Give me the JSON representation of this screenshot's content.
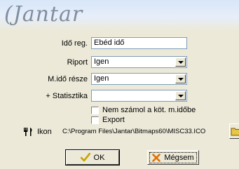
{
  "logo_text": "(Jantar",
  "form": {
    "ido_reg": {
      "label": "Idő reg.",
      "value": "Ebéd idő"
    },
    "riport": {
      "label": "Riport",
      "value": "Igen"
    },
    "mido_resze": {
      "label": "M.idő része",
      "value": "Igen"
    },
    "statisztika": {
      "label": "+ Statisztika",
      "value": ""
    }
  },
  "checkboxes": [
    {
      "label": "Nem számol a köt. m.időbe",
      "checked": false
    },
    {
      "label": "Export",
      "checked": false
    }
  ],
  "ikon": {
    "label": "Ikon",
    "path": "C:\\Program Files\\Jantar\\Bitmaps60\\MISC33.ICO",
    "icon": "fork-knife-icon"
  },
  "buttons": {
    "ok": {
      "label": "OK",
      "icon": "checkmark-icon"
    },
    "cancel": {
      "label": "Mégsem",
      "icon": "x-icon"
    }
  },
  "colors": {
    "checkmark": "#c9a000",
    "cancel_x": "#e07000",
    "field_border": "#7f9db9",
    "dialog_bg": "#ece9d8"
  }
}
